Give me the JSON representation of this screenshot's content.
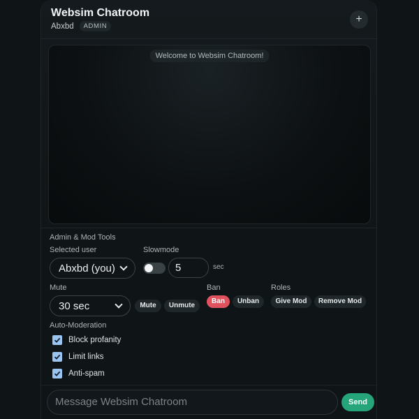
{
  "header": {
    "title": "Websim Chatroom",
    "username": "Abxbd",
    "role_badge": "ADMIN",
    "add_icon": "plus-icon"
  },
  "chat": {
    "welcome": "Welcome to Websim Chatroom!"
  },
  "tools": {
    "section_title": "Admin & Mod Tools",
    "selected_user_label": "Selected user",
    "selected_user_value": "Abxbd (you)",
    "slowmode_label": "Slowmode",
    "slowmode_enabled": false,
    "slowmode_value": "5",
    "slowmode_unit": "sec",
    "mute_label": "Mute",
    "mute_duration": "30 sec",
    "mute_button": "Mute",
    "unmute_button": "Unmute",
    "ban_label": "Ban",
    "ban_button": "Ban",
    "unban_button": "Unban",
    "roles_label": "Roles",
    "give_mod_button": "Give Mod",
    "remove_mod_button": "Remove Mod",
    "automod_label": "Auto-Moderation",
    "automod_options": [
      {
        "label": "Block profanity",
        "checked": true
      },
      {
        "label": "Limit links",
        "checked": true
      },
      {
        "label": "Anti-spam",
        "checked": true
      }
    ]
  },
  "composer": {
    "placeholder": "Message Websim Chatroom",
    "send_button": "Send"
  },
  "colors": {
    "accent_send": "#27a57a",
    "ban_red": "#e0525e",
    "checkbox_blue": "#9cc4f0",
    "background": "#0f1416"
  }
}
